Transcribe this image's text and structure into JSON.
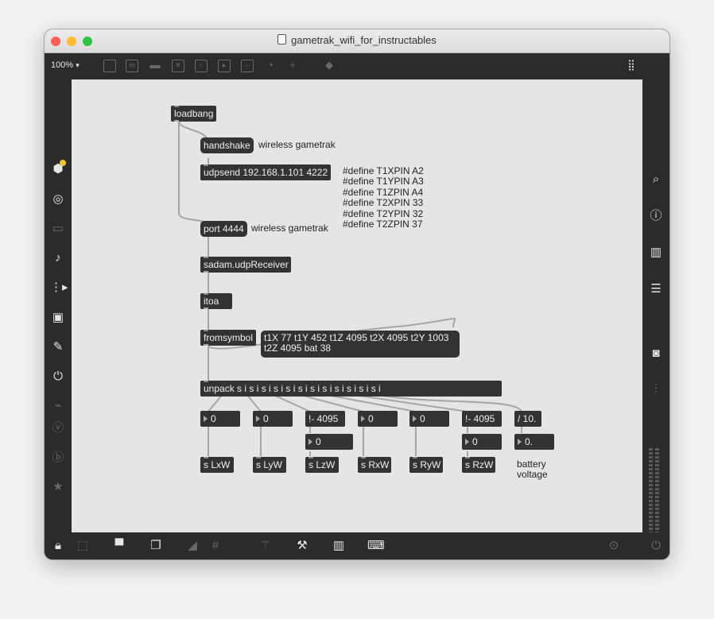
{
  "window": {
    "title": "gametrak_wifi_for_instructables"
  },
  "traffic_lights": {
    "close": "#ff5f57",
    "minimize": "#febc2e",
    "zoom": "#28c840"
  },
  "toolbar": {
    "zoom_label": "100%",
    "zoom_caret": "▾"
  },
  "patch": {
    "loadbang": "loadbang",
    "handshake": "handshake",
    "handshake_comment": "wireless gametrak",
    "udpsend": "udpsend 192.168.1.101 4222",
    "defines": "#define T1XPIN A2\n#define T1YPIN A3\n#define T1ZPIN A4\n#define T2XPIN 33\n#define T2YPIN 32\n#define T2ZPIN 37",
    "port": "port 4444",
    "port_comment": "wireless gametrak",
    "receiver": "sadam.udpReceiver",
    "itoa": "itoa",
    "fromsymbol": "fromsymbol",
    "message": "t1X 77 t1Y 452 t1Z 4095 t2X 4095 t2Y 1003 t2Z 4095 bat 38",
    "unpack": "unpack s i s i s i s i s i s i s i s i s i s i s i s i",
    "num_lx": "0",
    "num_ly": "0",
    "invert_z1": "!- 4095",
    "num_lz": "0",
    "num_rx": "0",
    "num_ry": "0",
    "invert_z2": "!- 4095",
    "num_rz": "0",
    "divide": "/ 10.",
    "num_battery": "0.",
    "send_lx": "s LxW",
    "send_ly": "s LyW",
    "send_lz": "s LzW",
    "send_rx": "s RxW",
    "send_ry": "s RyW",
    "send_rz": "s RzW",
    "battery_comment": "battery\nvoltage"
  },
  "colors": {
    "canvas": "#e5e5e5",
    "object": "#333333",
    "chrome": "#2b2b2b",
    "badge": "#f4c430",
    "cable": "#a6a6a6"
  },
  "icons": {
    "left_sidebar": [
      "cube-icon",
      "target-icon",
      "device-icon",
      "music-note-icon",
      "playlist-icon",
      "image-icon",
      "paperclip-icon",
      "plug-icon",
      "connector-icon",
      "v-icon",
      "b-icon",
      "star-icon"
    ],
    "right_sidebar": [
      "search-icon",
      "info-icon",
      "book-icon",
      "list-icon",
      "camera-icon",
      "sliders-icon"
    ],
    "bottom_bar": [
      "lock-icon",
      "edit-icon",
      "presentation-icon",
      "windows-icon",
      "hide-icon",
      "grid-icon",
      "magic-icon",
      "wrench-icon",
      "keyboard-icon",
      "midi-keyboard-icon",
      "play-icon",
      "power-icon"
    ]
  }
}
